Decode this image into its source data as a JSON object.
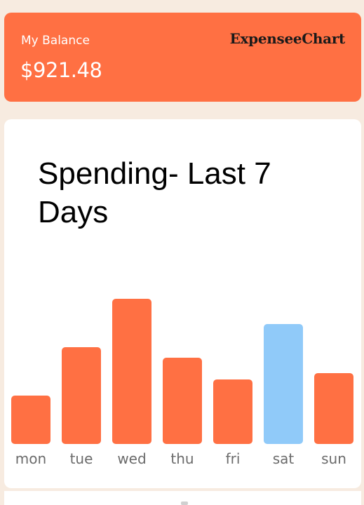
{
  "header": {
    "balance_label": "My Balance",
    "balance_amount": "$921.48",
    "brand_title": "ExpenseeChart"
  },
  "spending": {
    "title": "Spending- Last 7 Days"
  },
  "colors": {
    "accent": "#ff7043",
    "highlight": "#90caf9",
    "background": "#f7ebe0"
  },
  "chart_data": {
    "type": "bar",
    "title": "Spending- Last 7 Days",
    "categories": [
      "mon",
      "tue",
      "wed",
      "thu",
      "fri",
      "sat",
      "sun"
    ],
    "values": [
      17.45,
      34.91,
      52.36,
      31.07,
      23.39,
      43.28,
      25.48
    ],
    "highlight_category": "sat",
    "xlabel": "",
    "ylabel": "",
    "grid": false
  }
}
